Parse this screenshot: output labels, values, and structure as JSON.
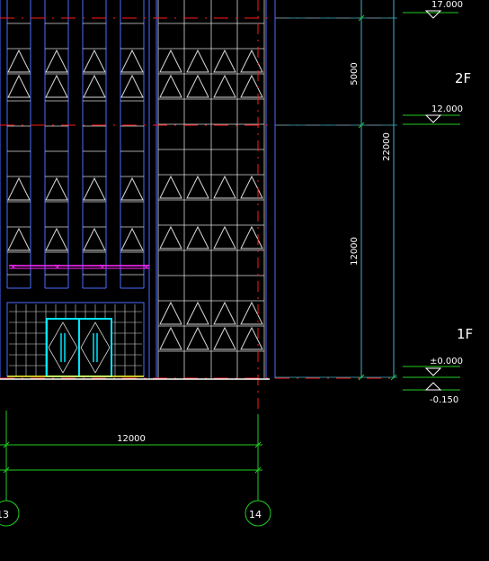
{
  "drawing": {
    "background": "#000000",
    "colors": {
      "outline": "#4a6cff",
      "panel": "#d9d9d9",
      "axis_red": "#ff1a1a",
      "dim_green": "#22cc22",
      "dim_cyan": "#3fb6c8",
      "door_cyan": "#00e5ff",
      "canopy_magenta": "#ff2aff",
      "ground": "#ffffff",
      "sill_yellow": "#ffff33"
    },
    "floors": [
      {
        "label": "2F"
      },
      {
        "label": "1F"
      }
    ],
    "levels": [
      {
        "value": "17.000",
        "partial": true
      },
      {
        "value": "12.000"
      },
      {
        "value": "±0.000"
      },
      {
        "value": "-0.150"
      }
    ],
    "dimensions": {
      "vertical_upper": "5000",
      "vertical_lower": "12000",
      "vertical_total": "22000",
      "horizontal_bay": "12000"
    },
    "axes": [
      {
        "label": "13",
        "partial": true
      },
      {
        "label": "14"
      }
    ]
  }
}
